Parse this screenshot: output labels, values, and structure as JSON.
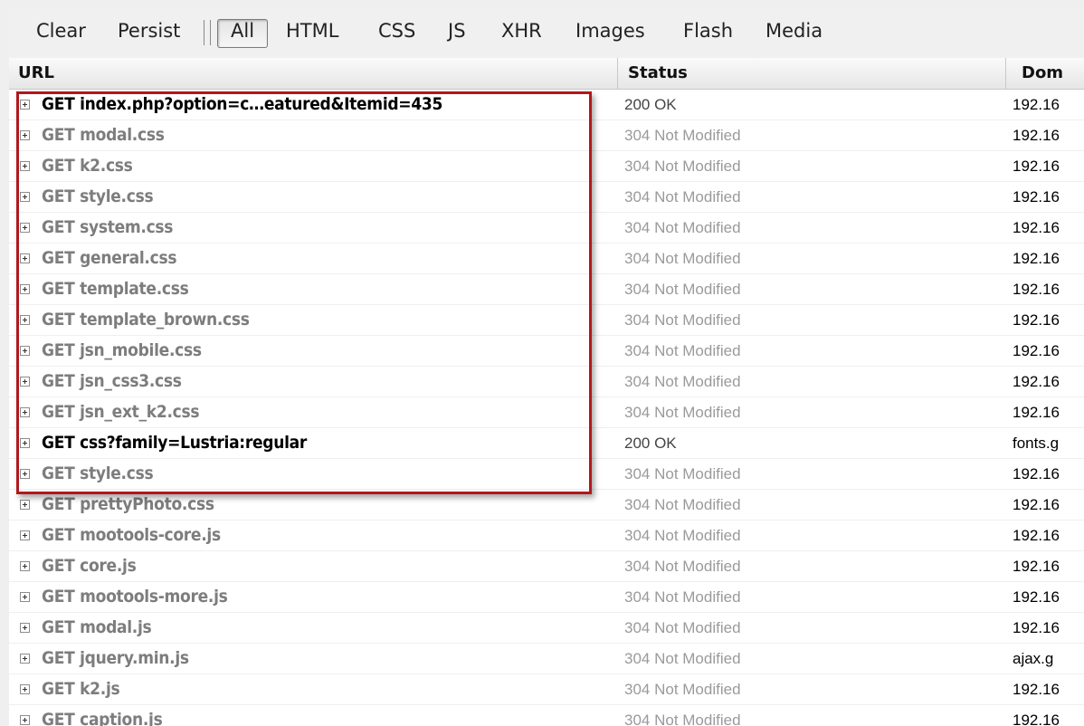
{
  "toolbar": {
    "clear": "Clear",
    "persist": "Persist",
    "all": "All",
    "html": "HTML",
    "css": "CSS",
    "js": "JS",
    "xhr": "XHR",
    "images": "Images",
    "flash": "Flash",
    "media": "Media"
  },
  "columns": {
    "url": "URL",
    "status": "Status",
    "domain": "Dom"
  },
  "rows": [
    {
      "url": "GET index.php?option=c…eatured&Itemid=435",
      "status": "200 OK",
      "domain": "192.16"
    },
    {
      "url": "GET modal.css",
      "status": "304 Not Modified",
      "domain": "192.16"
    },
    {
      "url": "GET k2.css",
      "status": "304 Not Modified",
      "domain": "192.16"
    },
    {
      "url": "GET style.css",
      "status": "304 Not Modified",
      "domain": "192.16"
    },
    {
      "url": "GET system.css",
      "status": "304 Not Modified",
      "domain": "192.16"
    },
    {
      "url": "GET general.css",
      "status": "304 Not Modified",
      "domain": "192.16"
    },
    {
      "url": "GET template.css",
      "status": "304 Not Modified",
      "domain": "192.16"
    },
    {
      "url": "GET template_brown.css",
      "status": "304 Not Modified",
      "domain": "192.16"
    },
    {
      "url": "GET jsn_mobile.css",
      "status": "304 Not Modified",
      "domain": "192.16"
    },
    {
      "url": "GET jsn_css3.css",
      "status": "304 Not Modified",
      "domain": "192.16"
    },
    {
      "url": "GET jsn_ext_k2.css",
      "status": "304 Not Modified",
      "domain": "192.16"
    },
    {
      "url": "GET css?family=Lustria:regular",
      "status": "200 OK",
      "domain": "fonts.g"
    },
    {
      "url": "GET style.css",
      "status": "304 Not Modified",
      "domain": "192.16"
    },
    {
      "url": "GET prettyPhoto.css",
      "status": "304 Not Modified",
      "domain": "192.16"
    },
    {
      "url": "GET mootools-core.js",
      "status": "304 Not Modified",
      "domain": "192.16"
    },
    {
      "url": "GET core.js",
      "status": "304 Not Modified",
      "domain": "192.16"
    },
    {
      "url": "GET mootools-more.js",
      "status": "304 Not Modified",
      "domain": "192.16"
    },
    {
      "url": "GET modal.js",
      "status": "304 Not Modified",
      "domain": "192.16"
    },
    {
      "url": "GET jquery.min.js",
      "status": "304 Not Modified",
      "domain": "ajax.g"
    },
    {
      "url": "GET k2.js",
      "status": "304 Not Modified",
      "domain": "192.16"
    },
    {
      "url": "GET caption.js",
      "status": "304 Not Modified",
      "domain": "192.16"
    }
  ],
  "colors": {
    "highlight_border": "#b0181d",
    "cached_text": "#7d7d7d",
    "ok_text": "#000000"
  }
}
